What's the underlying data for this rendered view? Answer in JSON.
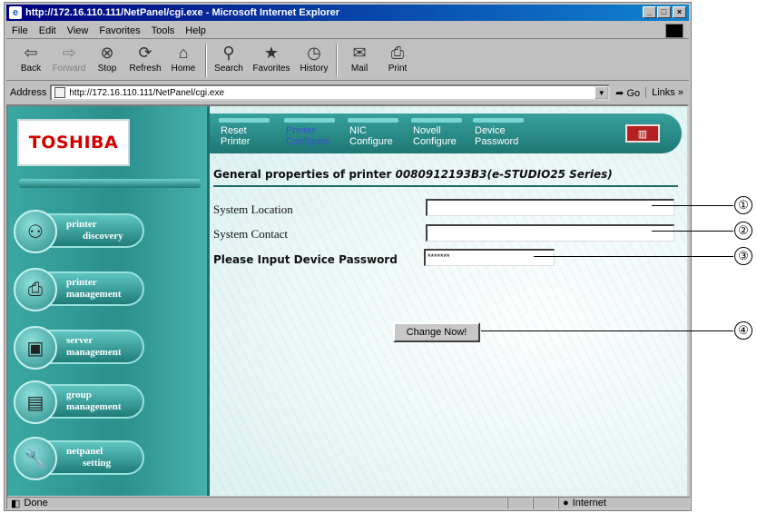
{
  "window": {
    "title": "http://172.16.110.111/NetPanel/cgi.exe - Microsoft Internet Explorer"
  },
  "menu": [
    "File",
    "Edit",
    "View",
    "Favorites",
    "Tools",
    "Help"
  ],
  "toolbar": {
    "back": "Back",
    "forward": "Forward",
    "stop": "Stop",
    "refresh": "Refresh",
    "home": "Home",
    "search": "Search",
    "favorites": "Favorites",
    "history": "History",
    "mail": "Mail",
    "print": "Print"
  },
  "address": {
    "label": "Address",
    "url": "http://172.16.110.111/NetPanel/cgi.exe",
    "go": "Go",
    "links": "Links"
  },
  "brand": {
    "logo": "TOSHIBA"
  },
  "sidenav": [
    {
      "line1": "printer",
      "line2": "discovery",
      "icon": "binoculars-icon"
    },
    {
      "line1": "printer",
      "line2": "management",
      "icon": "printer-gear-icon"
    },
    {
      "line1": "server",
      "line2": "management",
      "icon": "computers-icon"
    },
    {
      "line1": "group",
      "line2": "management",
      "icon": "printers-icon"
    },
    {
      "line1": "netpanel",
      "line2": "setting",
      "icon": "wrench-icon"
    }
  ],
  "topnav": [
    {
      "line1": "Reset",
      "line2": "Printer"
    },
    {
      "line1": "Printer",
      "line2": "Configure"
    },
    {
      "line1": "NIC",
      "line2": "Configure"
    },
    {
      "line1": "Novell",
      "line2": "Configure"
    },
    {
      "line1": "Device",
      "line2": "Password"
    }
  ],
  "heading": {
    "prefix": "General properties of printer",
    "model": "0080912193B3(e-STUDIO25 Series)"
  },
  "form": {
    "system_location_label": "System Location",
    "system_location_value": "",
    "system_contact_label": "System Contact",
    "system_contact_value": "",
    "password_label": "Please Input Device Password",
    "password_value": "*******",
    "submit_label": "Change Now!"
  },
  "status": {
    "text": "Done",
    "zone": "Internet"
  },
  "callouts": [
    "①",
    "②",
    "③",
    "④"
  ]
}
